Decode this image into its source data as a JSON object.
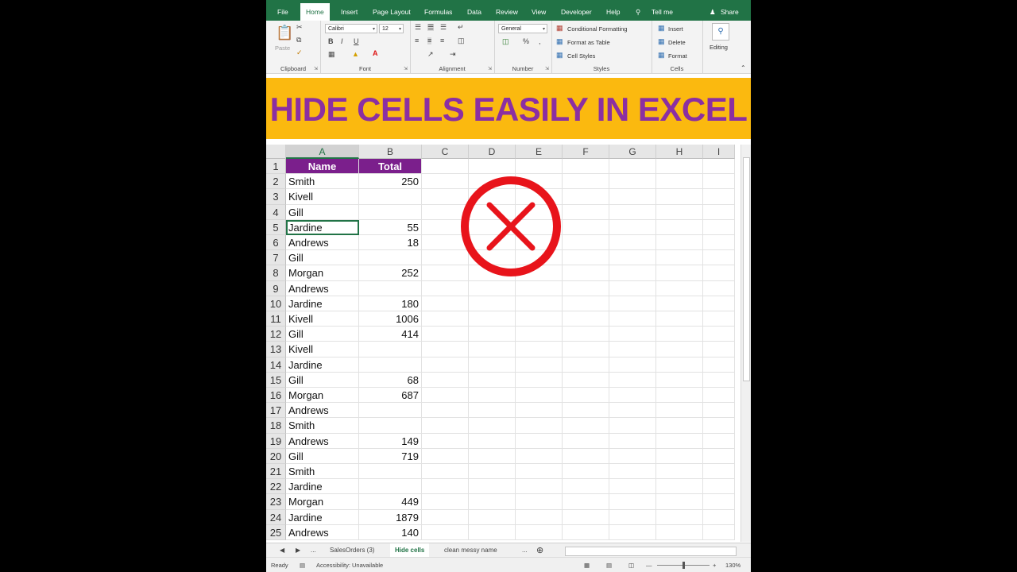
{
  "ribbon": {
    "tabs": [
      "File",
      "Home",
      "Insert",
      "Page Layout",
      "Formulas",
      "Data",
      "Review",
      "View",
      "Developer",
      "Help"
    ],
    "active_tab": "Home",
    "tell_me": "Tell me",
    "share": "Share",
    "clipboard": {
      "label": "Clipboard",
      "paste": "Paste"
    },
    "font": {
      "label": "Font",
      "name": "Calibri",
      "size": "12"
    },
    "alignment": {
      "label": "Alignment"
    },
    "number": {
      "label": "Number",
      "format": "General"
    },
    "styles": {
      "label": "Styles",
      "conditional": "Conditional Formatting",
      "format_table": "Format as Table",
      "cell_styles": "Cell Styles"
    },
    "cells": {
      "label": "Cells",
      "insert": "Insert",
      "delete": "Delete",
      "format": "Format"
    },
    "editing": {
      "label": "Editing"
    }
  },
  "banner": {
    "text": "HIDE CELLS EASILY IN EXCEL"
  },
  "colors": {
    "excel_green": "#217346",
    "banner_bg": "#fbb90f",
    "banner_text": "#8b2fa2",
    "header_fill": "#7b1f8c",
    "x_red": "#e8141b"
  },
  "grid": {
    "columns": [
      "A",
      "B",
      "C",
      "D",
      "E",
      "F",
      "G",
      "H",
      "I"
    ],
    "rows": [
      {
        "n": "1",
        "a": "Name",
        "b": "Total"
      },
      {
        "n": "2",
        "a": "Smith",
        "b": "250"
      },
      {
        "n": "3",
        "a": "Kivell",
        "b": ""
      },
      {
        "n": "4",
        "a": "Gill",
        "b": ""
      },
      {
        "n": "5",
        "a": "Jardine",
        "b": "55"
      },
      {
        "n": "6",
        "a": "Andrews",
        "b": "18"
      },
      {
        "n": "7",
        "a": "Gill",
        "b": ""
      },
      {
        "n": "8",
        "a": "Morgan",
        "b": "252"
      },
      {
        "n": "9",
        "a": "Andrews",
        "b": ""
      },
      {
        "n": "10",
        "a": "Jardine",
        "b": "180"
      },
      {
        "n": "11",
        "a": "Kivell",
        "b": "1006"
      },
      {
        "n": "12",
        "a": "Gill",
        "b": "414"
      },
      {
        "n": "13",
        "a": "Kivell",
        "b": ""
      },
      {
        "n": "14",
        "a": "Jardine",
        "b": ""
      },
      {
        "n": "15",
        "a": "Gill",
        "b": "68"
      },
      {
        "n": "16",
        "a": "Morgan",
        "b": "687"
      },
      {
        "n": "17",
        "a": "Andrews",
        "b": ""
      },
      {
        "n": "18",
        "a": "Smith",
        "b": ""
      },
      {
        "n": "19",
        "a": "Andrews",
        "b": "149"
      },
      {
        "n": "20",
        "a": "Gill",
        "b": "719"
      },
      {
        "n": "21",
        "a": "Smith",
        "b": ""
      },
      {
        "n": "22",
        "a": "Jardine",
        "b": ""
      },
      {
        "n": "23",
        "a": "Morgan",
        "b": "449"
      },
      {
        "n": "24",
        "a": "Jardine",
        "b": "1879"
      },
      {
        "n": "25",
        "a": "Andrews",
        "b": "140"
      }
    ],
    "selected_cell": "A5"
  },
  "sheets": {
    "tabs": [
      "SalesOrders (3)",
      "Hide cells",
      "clean messy name"
    ],
    "active": "Hide cells",
    "more": "..."
  },
  "status": {
    "ready": "Ready",
    "accessibility": "Accessibility: Unavailable",
    "zoom": "130%"
  },
  "icons": [
    "lightbulb-icon",
    "person-icon",
    "paste-icon",
    "cut-icon",
    "copy-icon",
    "format-painter-icon",
    "bold-icon",
    "italic-icon",
    "underline-icon",
    "borders-icon",
    "fill-color-icon",
    "font-color-icon",
    "align-icon",
    "wrap-icon",
    "merge-icon",
    "percent-icon",
    "comma-icon",
    "search-icon",
    "x-mark-icon"
  ]
}
